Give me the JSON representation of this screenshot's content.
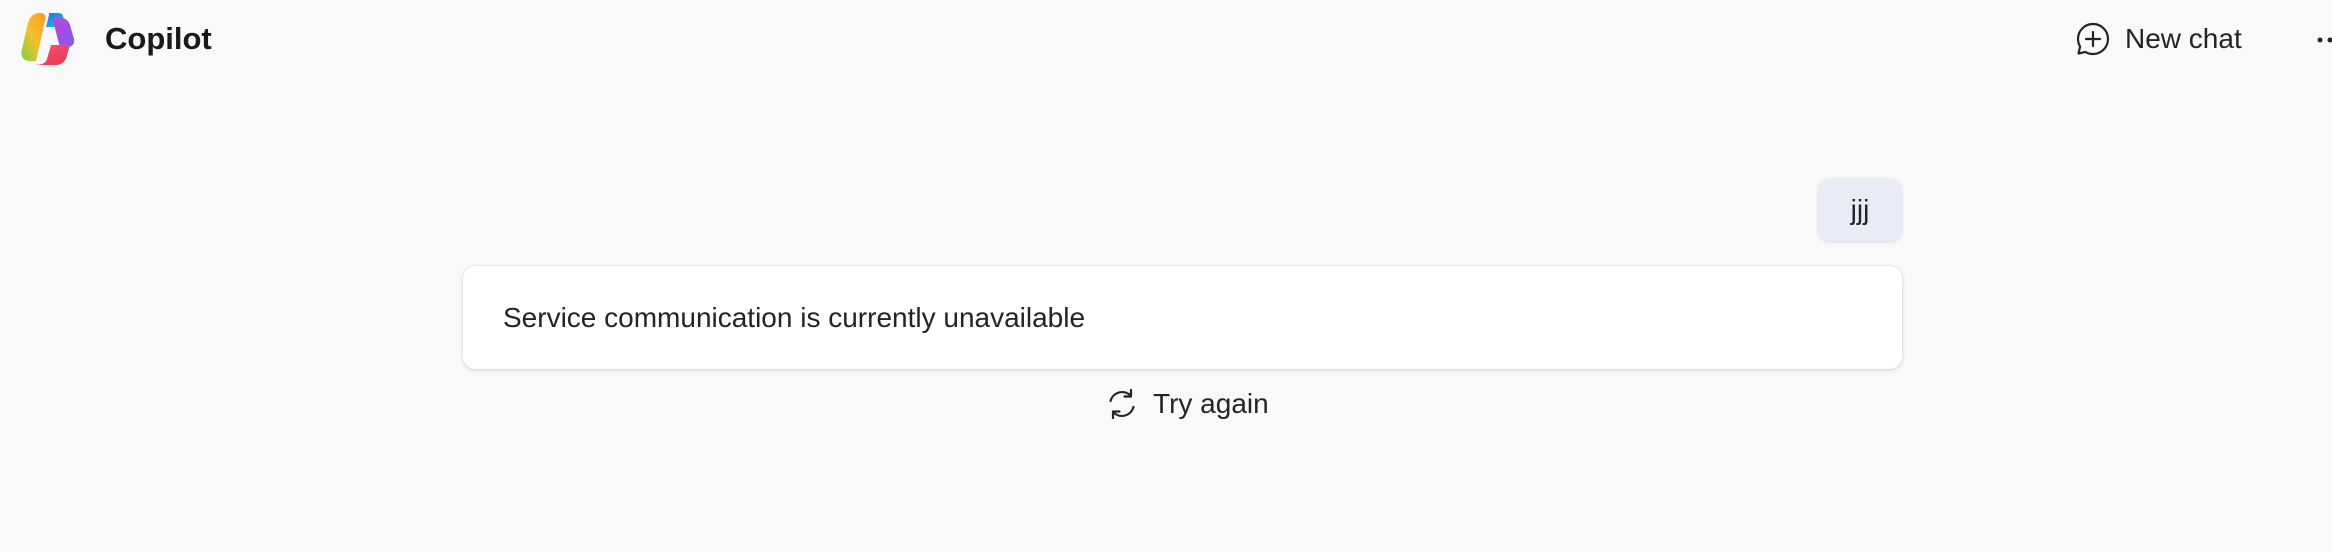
{
  "header": {
    "app_title": "Copilot",
    "logo_icon": "copilot-logo",
    "new_chat_label": "New chat",
    "new_chat_icon": "chat-add-icon",
    "more_icon": "more-options-icon"
  },
  "conversation": {
    "user_message": "jjj",
    "error_message": "Service communication is currently unavailable",
    "retry_label": "Try again",
    "retry_icon": "refresh-icon"
  },
  "colors": {
    "background": "#f9f9f9",
    "user_bubble": "#e9ebf6",
    "card": "#ffffff",
    "text": "#242424"
  }
}
